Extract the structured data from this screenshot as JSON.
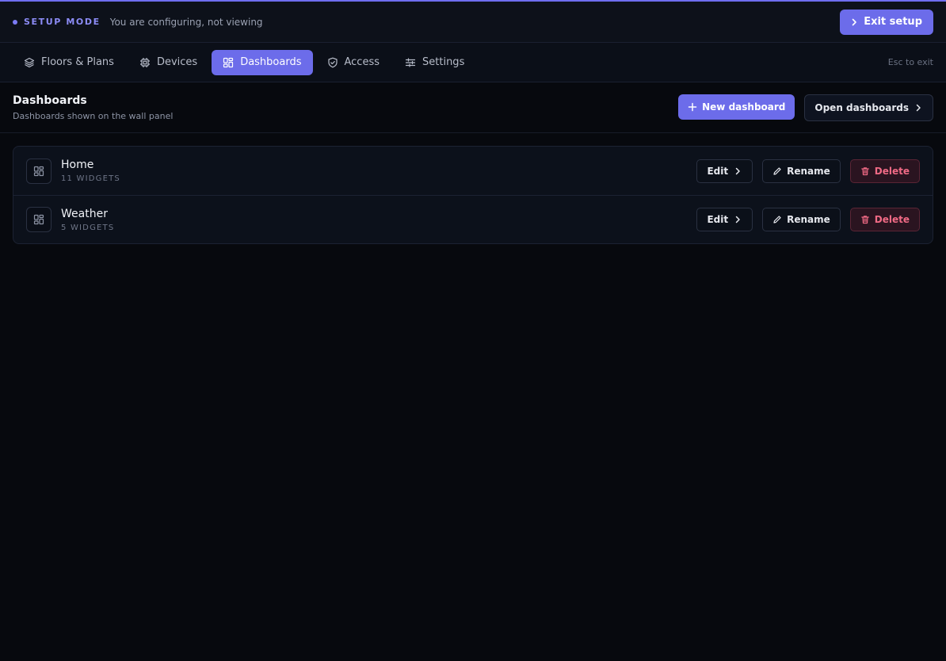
{
  "setup": {
    "mode_label": "SETUP MODE",
    "description": "You are configuring, not viewing",
    "exit_label": "Exit setup"
  },
  "nav": {
    "tabs": [
      {
        "label": "Floors & Plans",
        "icon": "layers-icon"
      },
      {
        "label": "Devices",
        "icon": "chip-icon"
      },
      {
        "label": "Dashboards",
        "icon": "dashboard-icon",
        "active": true
      },
      {
        "label": "Access",
        "icon": "shield-icon"
      },
      {
        "label": "Settings",
        "icon": "sliders-icon"
      }
    ],
    "esc_hint": "Esc to exit"
  },
  "page": {
    "title": "Dashboards",
    "subtitle": "Dashboards shown on the wall panel",
    "new_label": "New dashboard",
    "open_label": "Open dashboards"
  },
  "dashboards": [
    {
      "name": "Home",
      "count": "11 WIDGETS"
    },
    {
      "name": "Weather",
      "count": "5 WIDGETS"
    }
  ],
  "actions": {
    "edit": "Edit",
    "rename": "Rename",
    "delete": "Delete"
  },
  "colors": {
    "accent": "#6c6cea",
    "danger": "#f06a85",
    "background": "#07090e"
  }
}
